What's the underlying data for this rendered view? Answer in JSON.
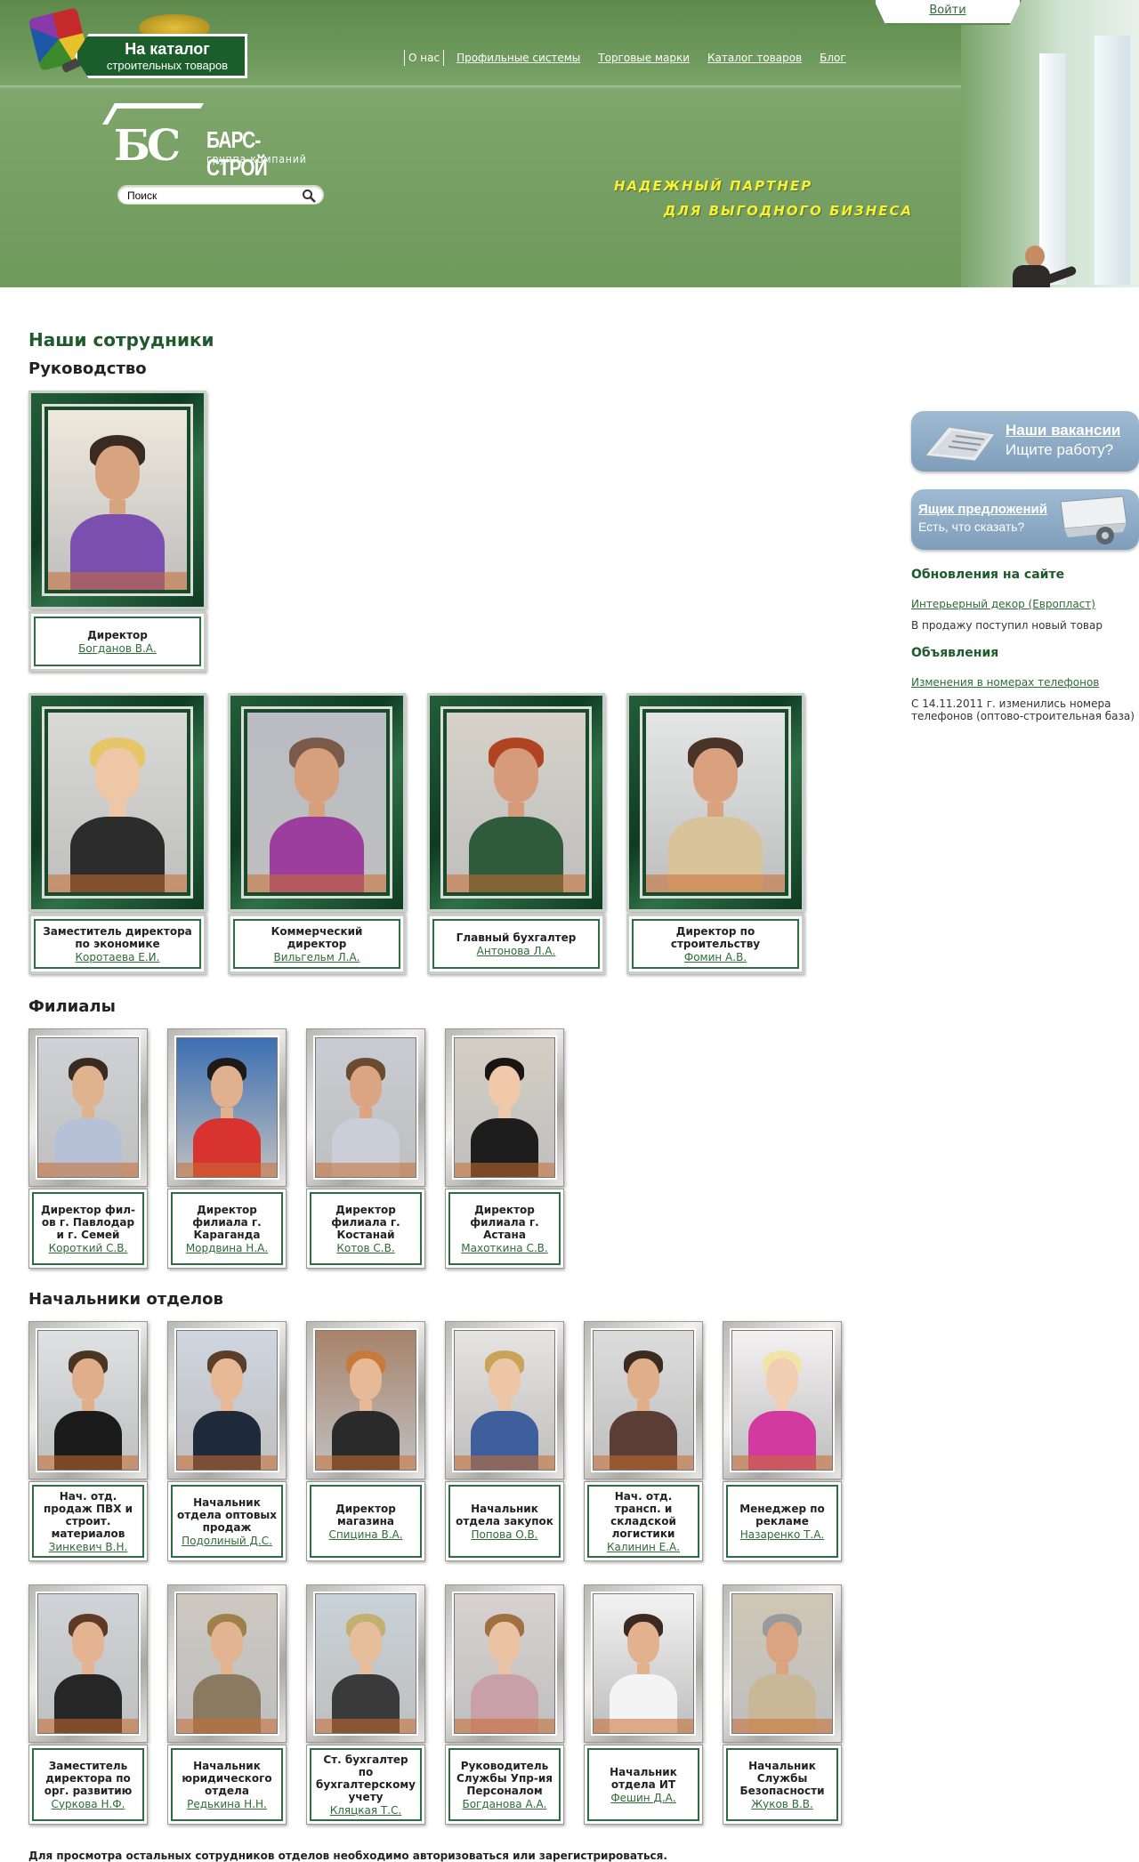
{
  "header": {
    "login_label": "Войти",
    "catalog_sign": {
      "line1": "На каталог",
      "line2": "строительных товаров"
    },
    "nav": {
      "current": "О нас",
      "links": [
        "Профильные системы",
        "Торговые марки",
        "Каталог товаров",
        "Блог"
      ]
    },
    "logo": {
      "letters": "БС",
      "name": "БАРС-СТРОЙ",
      "sub": "группа компаний"
    },
    "search": {
      "value": "Поиск"
    },
    "slogan": {
      "line1": "НАДЕЖНЫЙ ПАРТНЕР",
      "line2": "ДЛЯ ВЫГОДНОГО БИЗНЕСА"
    }
  },
  "main": {
    "page_title": "Наши сотрудники",
    "sections": {
      "management": {
        "title": "Руководство",
        "director": {
          "position": "Директор",
          "name": "Богданов В.А."
        },
        "row": [
          {
            "position": "Заместитель директора по экономике",
            "name": "Коротаева Е.И."
          },
          {
            "position": "Коммерческий директор",
            "name": "Вильгельм Л.А."
          },
          {
            "position": "Главный бухгалтер",
            "name": "Антонова Л.А."
          },
          {
            "position": "Директор по строительству",
            "name": "Фомин А.В."
          }
        ]
      },
      "branches": {
        "title": "Филиалы",
        "items": [
          {
            "position": "Директор фил-ов г. Павлодар и г. Семей",
            "name": "Короткий С.В."
          },
          {
            "position": "Директор филиала г. Караганда",
            "name": "Мордвина Н.А."
          },
          {
            "position": "Директор филиала г. Костанай",
            "name": "Котов С.В."
          },
          {
            "position": "Директор филиала г. Астана",
            "name": "Махоткина С.В."
          }
        ]
      },
      "heads": {
        "title": "Начальники отделов",
        "row1": [
          {
            "position": "Нач. отд. продаж ПВХ и строит. материалов",
            "name": "Зинкевич В.Н."
          },
          {
            "position": "Начальник отдела оптовых продаж",
            "name": "Подолиный Д.С."
          },
          {
            "position": "Директор магазина",
            "name": "Спицина В.А."
          },
          {
            "position": "Начальник отдела закупок",
            "name": "Попова О.В."
          },
          {
            "position": "Нач. отд. трансп. и складской логистики",
            "name": "Калинин Е.А."
          },
          {
            "position": "Менеджер по рекламе",
            "name": "Назаренко Т.А."
          }
        ],
        "row2": [
          {
            "position": "Заместитель директора по орг. развитию",
            "name": "Суркова Н.Ф."
          },
          {
            "position": "Начальник юридического отдела",
            "name": "Редькина Н.Н."
          },
          {
            "position": "Ст. бухгалтер по бухгалтерскому учету",
            "name": "Кляцкая Т.С."
          },
          {
            "position": "Руководитель Службы Упр-ия Персоналом",
            "name": "Богданова А.А."
          },
          {
            "position": "Начальник отдела ИТ",
            "name": "Фешин Д.А."
          },
          {
            "position": "Начальник Службы Безопасности",
            "name": "Жуков В.В."
          }
        ]
      }
    },
    "footnote": "Для просмотра остальных сотрудников отделов необходимо авторизоваться или зарегистрироваться."
  },
  "sidebar": {
    "vacancies": {
      "title": "Наши вакансии",
      "sub": "Ищите работу?"
    },
    "ideas": {
      "title": "Ящик предложений",
      "sub": "Есть, что сказать?"
    },
    "updates": {
      "heading": "Обновления на сайте",
      "link": "Интерьерный декор (Европласт)",
      "text": "В продажу поступил новый товар"
    },
    "ads": {
      "heading": "Объявления",
      "link": "Изменения в номерах телефонов",
      "text": "С 14.11.2011 г. изменились номера телефонов (оптово-строительная база)"
    }
  },
  "colors": {
    "brand_green": "#1f5a2c",
    "link_green": "#2d6b38",
    "header_green": "#7ea56a",
    "slogan_yellow": "#f7f033"
  }
}
